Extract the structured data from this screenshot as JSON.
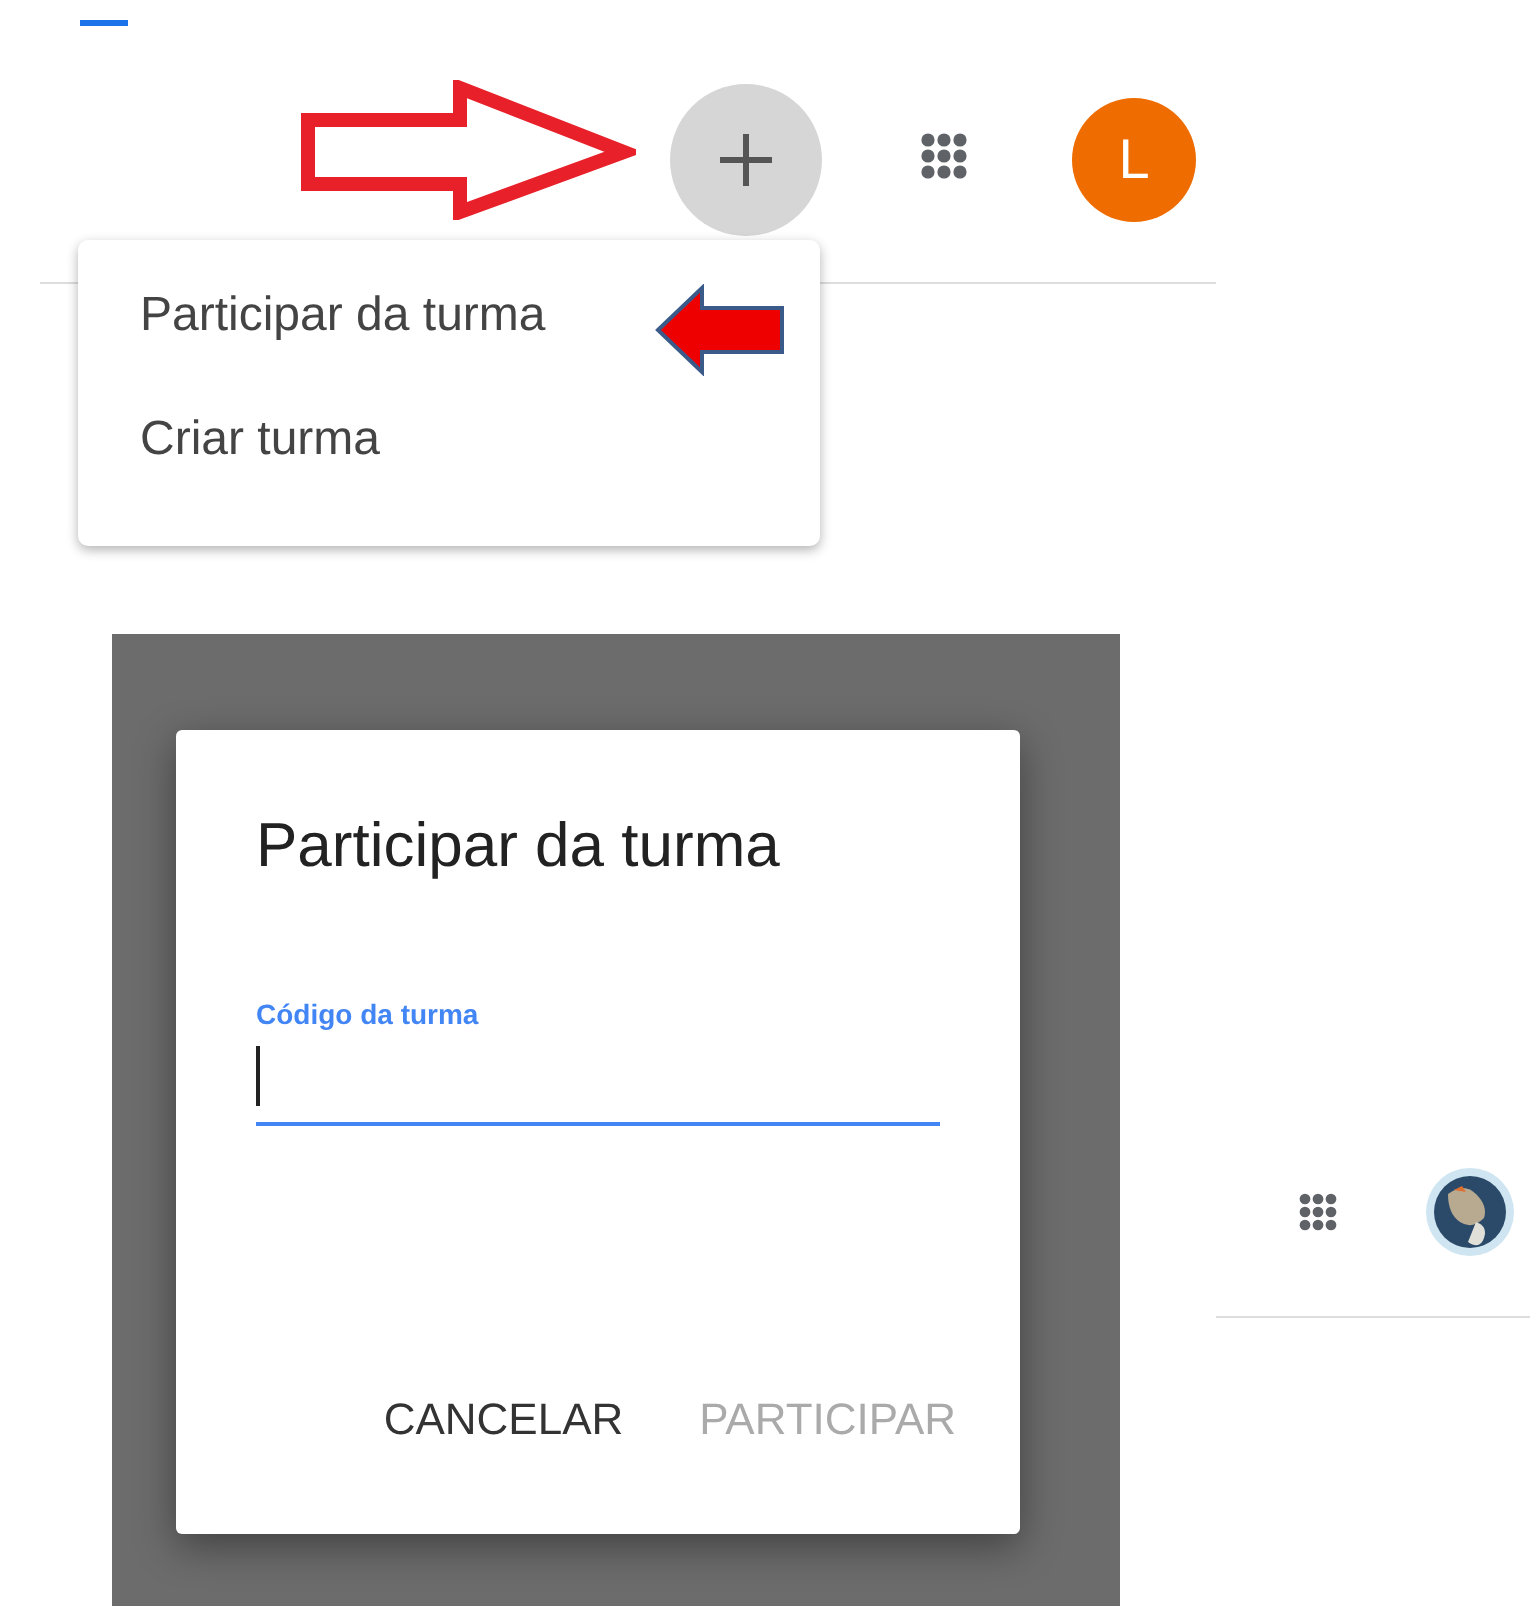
{
  "header": {
    "avatar_letter": "L"
  },
  "add_menu": {
    "items": [
      {
        "label": "Participar da turma"
      },
      {
        "label": "Criar turma"
      }
    ]
  },
  "dialog": {
    "title": "Participar da turma",
    "field": {
      "label": "Código da turma",
      "focused": true
    },
    "buttons": [
      {
        "label": "CANCELAR",
        "disabled": false
      },
      {
        "label": "PARTICIPAR",
        "disabled": true
      }
    ]
  }
}
